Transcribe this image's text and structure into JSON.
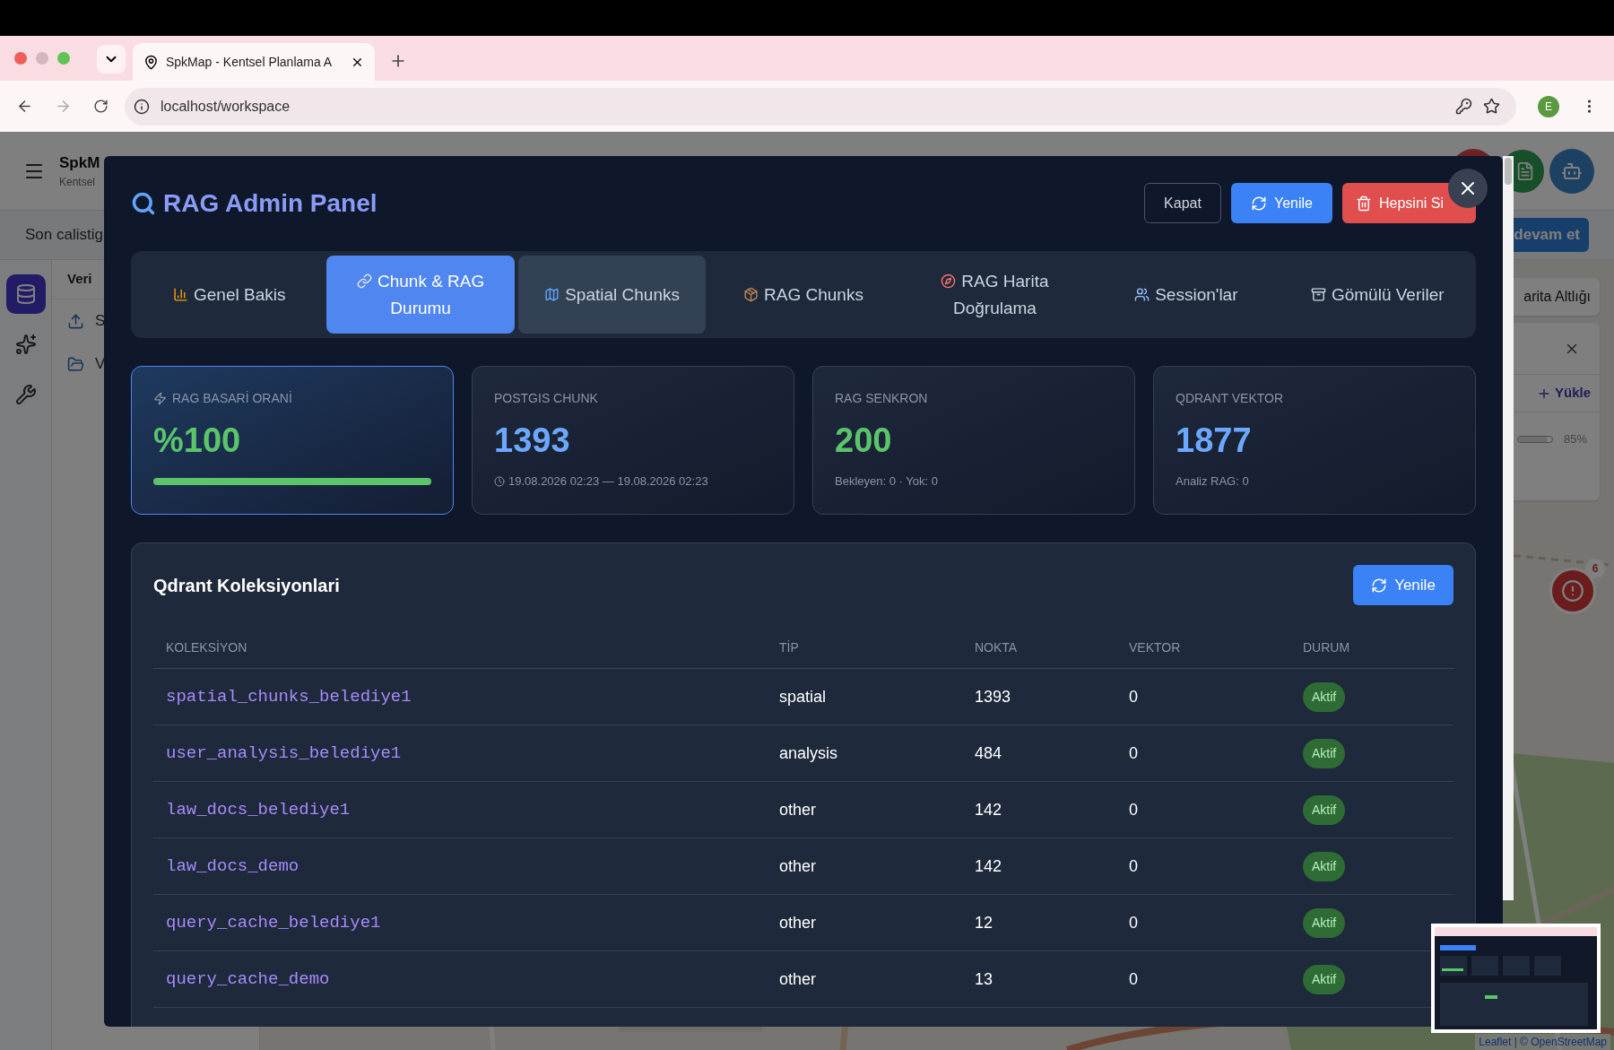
{
  "browser": {
    "tab_title": "SpkMap - Kentsel Planlama A",
    "url": "localhost/workspace",
    "profile_initial": "E"
  },
  "app": {
    "brand": "SpkM",
    "subtitle": "Kentsel",
    "resume_text": "Son calistig",
    "resume_button": "devam et",
    "panel_title": "Veri",
    "panel_items": [
      {
        "label": "S",
        "kind": "upload"
      },
      {
        "label": "V",
        "kind": "folder"
      }
    ],
    "rail": [
      {
        "kind": "database",
        "selected": true
      },
      {
        "kind": "sparkles",
        "selected": false
      },
      {
        "kind": "wrench",
        "selected": false
      }
    ],
    "layer_title": "arita Altlığı",
    "layer_action": "Yükle",
    "layer_slider": {
      "level": 0.85
    },
    "layer_reading": "85%",
    "alert_count": "6",
    "attribution": "Leaflet | © OpenStreetMap"
  },
  "modal": {
    "title": "RAG Admin Panel",
    "buttons": [
      {
        "label": "Kapat",
        "kind": "outline"
      },
      {
        "label": "Yenile",
        "kind": "refresh"
      },
      {
        "label": "Hepsini Si",
        "kind": "danger"
      }
    ],
    "tabs": [
      {
        "label": "Genel Bakis",
        "kind": "chart",
        "selected": false,
        "hovered": false
      },
      {
        "label": "Chunk & RAG Durumu",
        "kind": "link",
        "selected": true,
        "hovered": false
      },
      {
        "label": "Spatial Chunks",
        "kind": "map",
        "selected": false,
        "hovered": true
      },
      {
        "label": "RAG Chunks",
        "kind": "box",
        "selected": false,
        "hovered": false
      },
      {
        "label": "RAG Harita Doğrulama",
        "kind": "compass",
        "selected": false,
        "hovered": false
      },
      {
        "label": "Session'lar",
        "kind": "people",
        "selected": false,
        "hovered": false
      },
      {
        "label": "Gömülü Veriler",
        "kind": "cabinet",
        "selected": false,
        "hovered": false
      }
    ],
    "stats": [
      {
        "label": "RAG BASARİ ORANİ",
        "value": "%100",
        "color": "#5cc46a",
        "kind": "progress",
        "level": 1,
        "highlighted": true
      },
      {
        "label": "POSTGIS CHUNK",
        "value": "1393",
        "color": "#6ea8fe",
        "kind": "time",
        "note": "19.08.2026 02:23 — 19.08.2026 02:23",
        "highlighted": false
      },
      {
        "label": "RAG SENKRON",
        "value": "200",
        "color": "#5cc46a",
        "kind": "note",
        "note": "Bekleyen: 0 · Yok: 0",
        "highlighted": false
      },
      {
        "label": "QDRANT VEKTOR",
        "value": "1877",
        "color": "#6ea8fe",
        "kind": "note",
        "note": "Analiz RAG: 0",
        "highlighted": false
      }
    ],
    "collections": {
      "title": "Qdrant Koleksiyonlari",
      "button": "Yenile",
      "columns": [
        "KOLEKSİYON",
        "TİP",
        "NOKTA",
        "VEKTOR",
        "DURUM"
      ],
      "rows": [
        {
          "name": "spatial_chunks_belediye1",
          "type": "spatial",
          "points": "1393",
          "vectors": "0",
          "status": "Aktif"
        },
        {
          "name": "user_analysis_belediye1",
          "type": "analysis",
          "points": "484",
          "vectors": "0",
          "status": "Aktif"
        },
        {
          "name": "law_docs_belediye1",
          "type": "other",
          "points": "142",
          "vectors": "0",
          "status": "Aktif"
        },
        {
          "name": "law_docs_demo",
          "type": "other",
          "points": "142",
          "vectors": "0",
          "status": "Aktif"
        },
        {
          "name": "query_cache_belediye1",
          "type": "other",
          "points": "12",
          "vectors": "0",
          "status": "Aktif"
        },
        {
          "name": "query_cache_demo",
          "type": "other",
          "points": "13",
          "vectors": "0",
          "status": "Aktif"
        }
      ]
    }
  }
}
